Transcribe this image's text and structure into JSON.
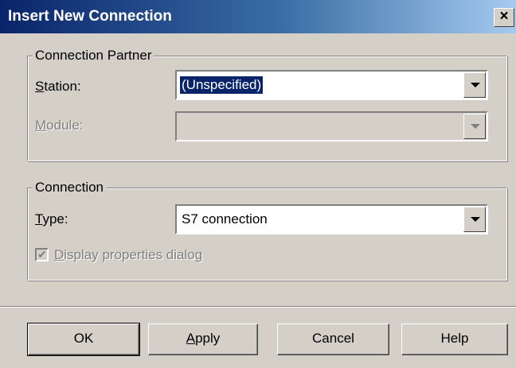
{
  "window": {
    "title": "Insert New Connection",
    "close_label": "×"
  },
  "partner_group": {
    "legend": "Connection Partner",
    "station_label_ul": "S",
    "station_label_rest": "tation:",
    "station_value": "(Unspecified)",
    "module_label_ul": "M",
    "module_label_rest": "odule:",
    "module_value": ""
  },
  "connection_group": {
    "legend": "Connection",
    "type_label_ul": "T",
    "type_label_rest": "ype:",
    "type_value": "S7 connection",
    "display_props_ul": "D",
    "display_props_rest": "isplay properties dialog",
    "display_props_checked": true
  },
  "buttons": {
    "ok": "OK",
    "apply_ul": "A",
    "apply_rest": "pply",
    "cancel": "Cancel",
    "help": "Help"
  },
  "colors": {
    "titlebar_start": "#0a246a",
    "titlebar_end": "#a6caf0",
    "dialog_face": "#d4d0c8",
    "selection": "#0a246a"
  }
}
